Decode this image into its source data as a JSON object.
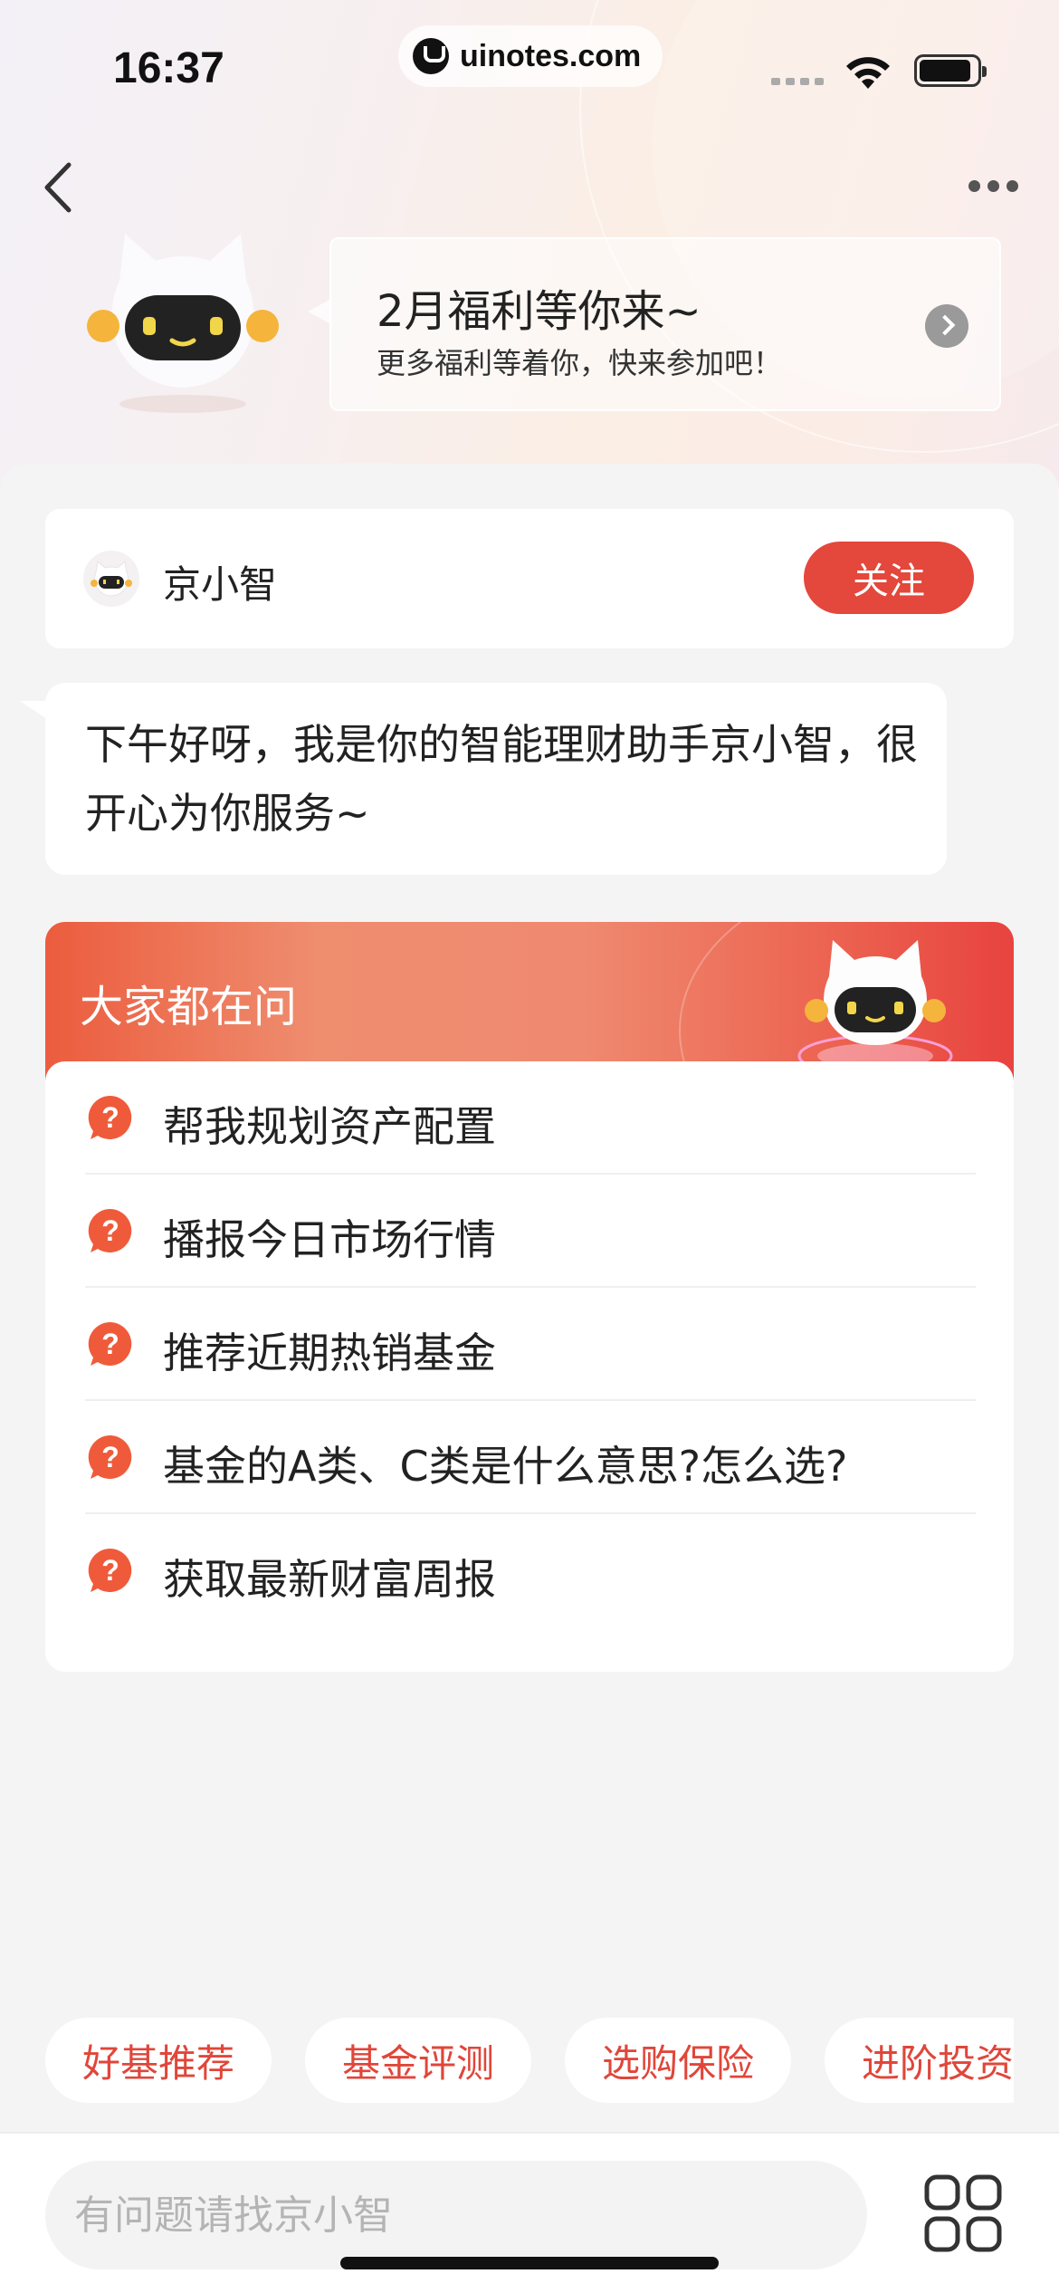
{
  "status_bar": {
    "time": "16:37",
    "url": "uinotes.com"
  },
  "welfare": {
    "title": "2月福利等你来~",
    "subtitle": "更多福利等着你，快来参加吧！"
  },
  "profile": {
    "name": "京小智",
    "follow_label": "关注"
  },
  "greeting": {
    "text": "下午好呀，我是你的智能理财助手京小智，很开心为你服务~"
  },
  "faq": {
    "title": "大家都在问",
    "items": [
      "帮我规划资产配置",
      "播报今日市场行情",
      "推荐近期热销基金",
      "基金的A类、C类是什么意思?怎么选?",
      "获取最新财富周报"
    ]
  },
  "quick_chips": [
    "好基推荐",
    "基金评测",
    "选购保险",
    "进阶投资"
  ],
  "input": {
    "placeholder": "有问题请找京小智"
  },
  "colors": {
    "accent": "#e4473b",
    "chip_text": "#e0463a",
    "question_icon": "#ef5b3a"
  },
  "icons": {
    "back": "chevron-left-icon",
    "more": "more-dots-icon",
    "welfare_arrow": "chevron-right-circle-icon",
    "question": "question-bubble-icon",
    "grid": "grid-menu-icon"
  }
}
